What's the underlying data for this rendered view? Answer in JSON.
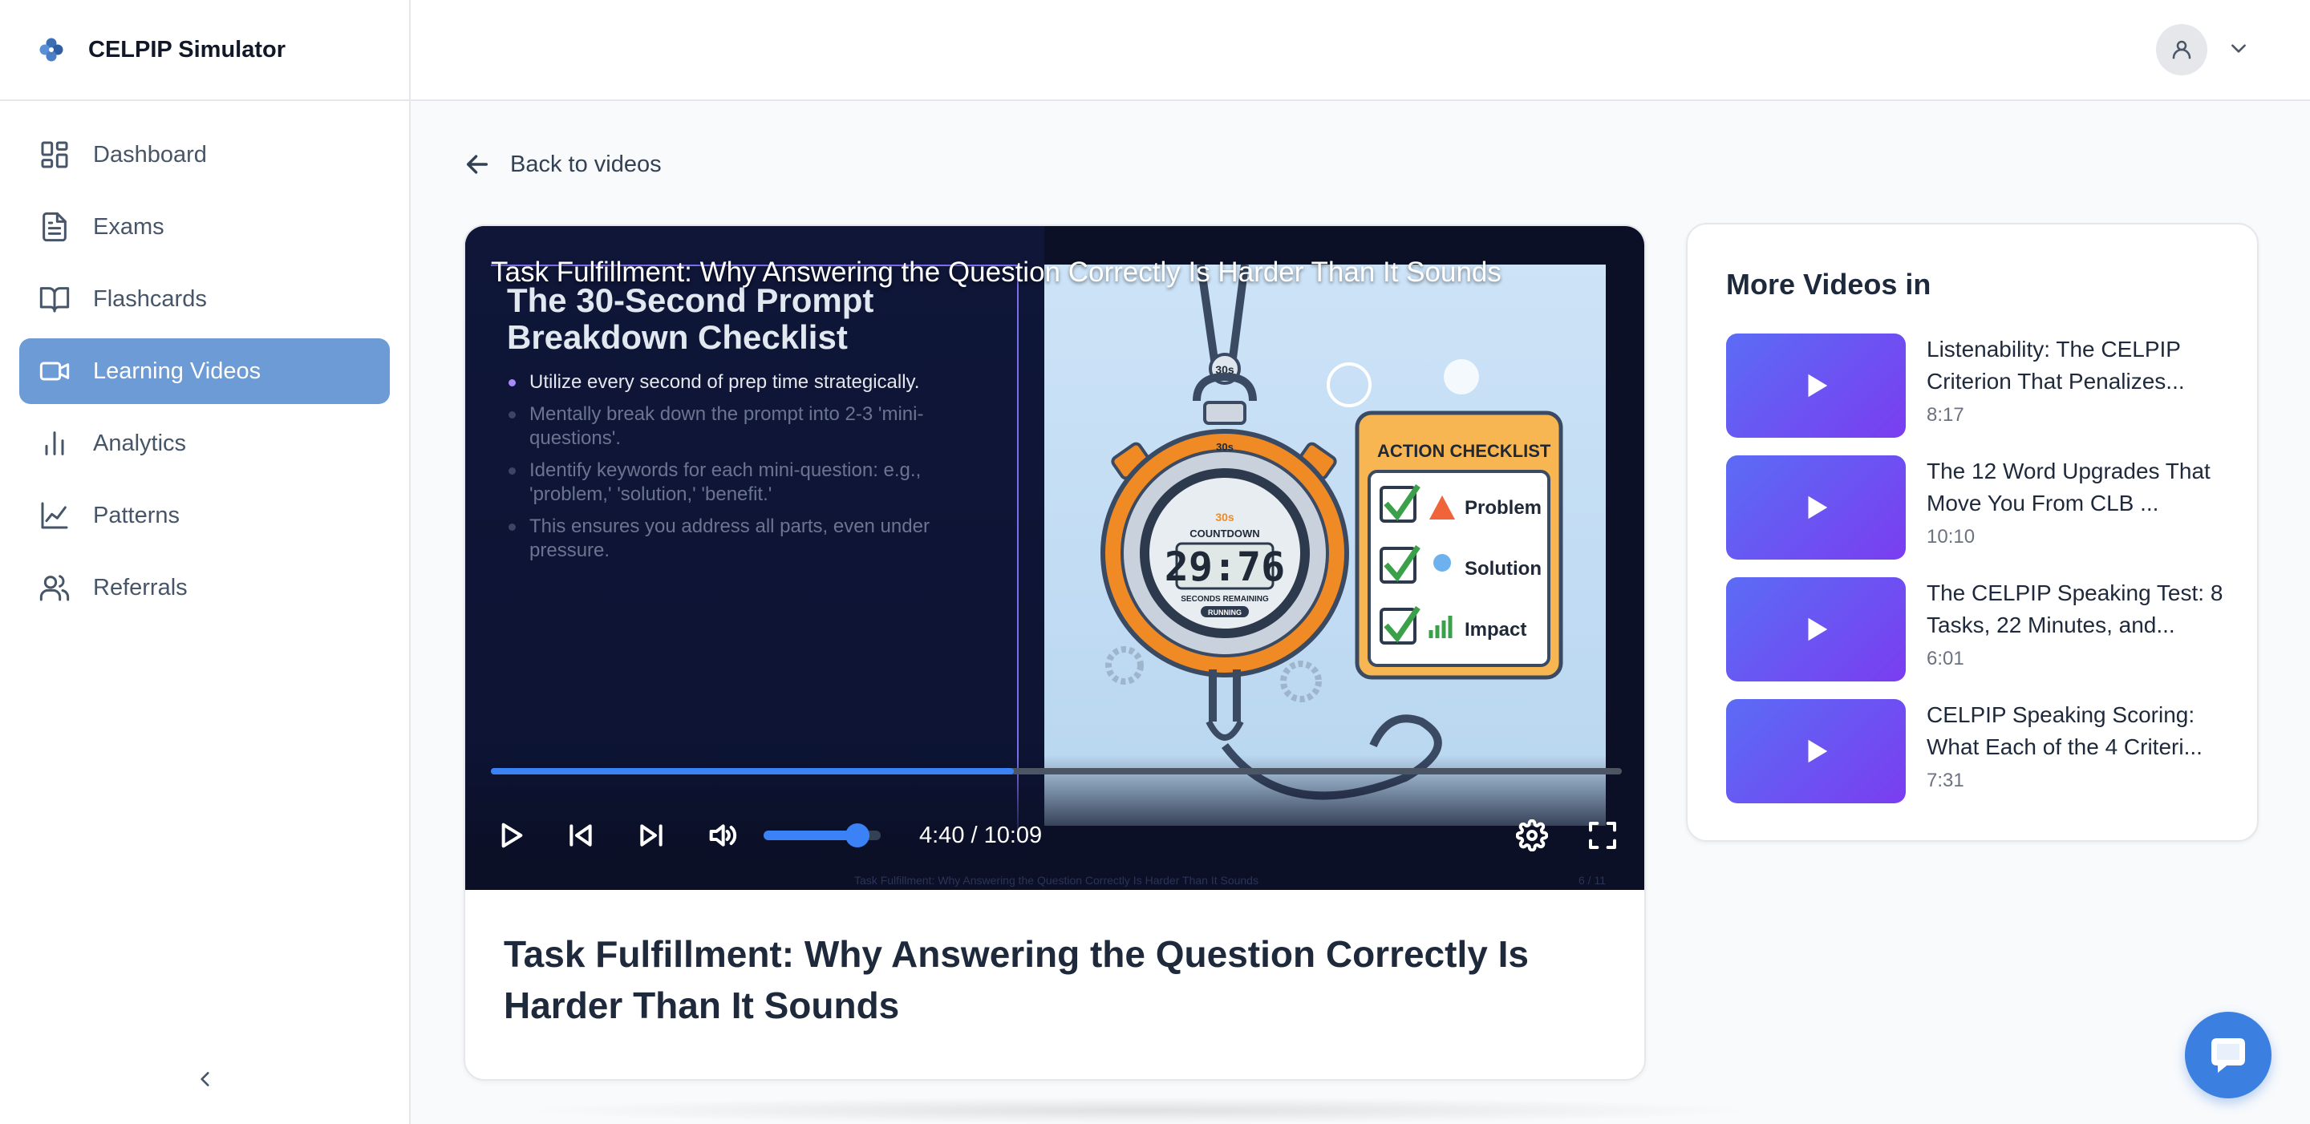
{
  "app": {
    "name": "CELPIP Simulator",
    "logo_icon": "clover-logo-icon"
  },
  "sidebar": {
    "items": [
      {
        "label": "Dashboard",
        "icon": "dashboard-grid-icon",
        "active": false
      },
      {
        "label": "Exams",
        "icon": "document-icon",
        "active": false
      },
      {
        "label": "Flashcards",
        "icon": "book-open-icon",
        "active": false
      },
      {
        "label": "Learning Videos",
        "icon": "video-camera-icon",
        "active": true
      },
      {
        "label": "Analytics",
        "icon": "bar-chart-icon",
        "active": false
      },
      {
        "label": "Patterns",
        "icon": "line-chart-icon",
        "active": false
      },
      {
        "label": "Referrals",
        "icon": "users-icon",
        "active": false
      }
    ],
    "collapse_icon": "chevron-left-icon"
  },
  "header": {
    "user_icon": "user-icon",
    "dropdown_icon": "chevron-down-icon"
  },
  "back_link": {
    "label": "Back to videos",
    "icon": "arrow-left-icon"
  },
  "player": {
    "overlay_title": "Task Fulfillment: Why Answering the Question Correctly Is Harder Than It Sounds",
    "slide": {
      "heading": "The 30-Second Prompt Breakdown Checklist",
      "bullets": [
        "Utilize every second of prep time strategically.",
        "Mentally break down the prompt into 2-3 'mini-questions'.",
        "Identify keywords for each mini-question: e.g., 'problem,' 'solution,' 'benefit.'",
        "This ensures you address all parts, even under pressure."
      ],
      "stopwatch_top": "30s",
      "stopwatch_label": "30s",
      "stopwatch_sub": "COUNTDOWN",
      "stopwatch_time": "29:76",
      "stopwatch_remaining": "SECONDS REMAINING",
      "stopwatch_status": "RUNNING",
      "checklist_title": "ACTION CHECKLIST",
      "checklist_items": [
        "Problem",
        "Solution",
        "Impact"
      ],
      "footer_text": "Task Fulfillment: Why Answering the Question Correctly Is Harder Than It Sounds",
      "footer_page": "6 / 11"
    },
    "progress_fraction": 0.4625,
    "volume_fraction": 0.8,
    "time_display": "4:40 / 10:09",
    "controls": {
      "play_icon": "play-icon",
      "prev_icon": "skip-back-icon",
      "next_icon": "skip-forward-icon",
      "volume_icon": "volume-icon",
      "settings_icon": "gear-icon",
      "fullscreen_icon": "fullscreen-icon"
    }
  },
  "video": {
    "title": "Task Fulfillment: Why Answering the Question Correctly Is Harder Than It Sounds"
  },
  "more_videos": {
    "title": "More Videos in",
    "items": [
      {
        "title": "Listenability: The CELPIP Criterion That Penalizes...",
        "duration": "8:17"
      },
      {
        "title": "The 12 Word Upgrades That Move You From CLB ...",
        "duration": "10:10"
      },
      {
        "title": "The CELPIP Speaking Test: 8 Tasks, 22 Minutes, and...",
        "duration": "6:01"
      },
      {
        "title": "CELPIP Speaking Scoring: What Each of the 4 Criteri...",
        "duration": "7:31"
      }
    ]
  },
  "chat": {
    "icon": "chat-bubble-icon"
  },
  "colors": {
    "accent": "#6d9bd6",
    "progress": "#3b82f6",
    "chat": "#3b7fe0",
    "thumb_start": "#5b6cf5",
    "thumb_end": "#7a3df0"
  }
}
